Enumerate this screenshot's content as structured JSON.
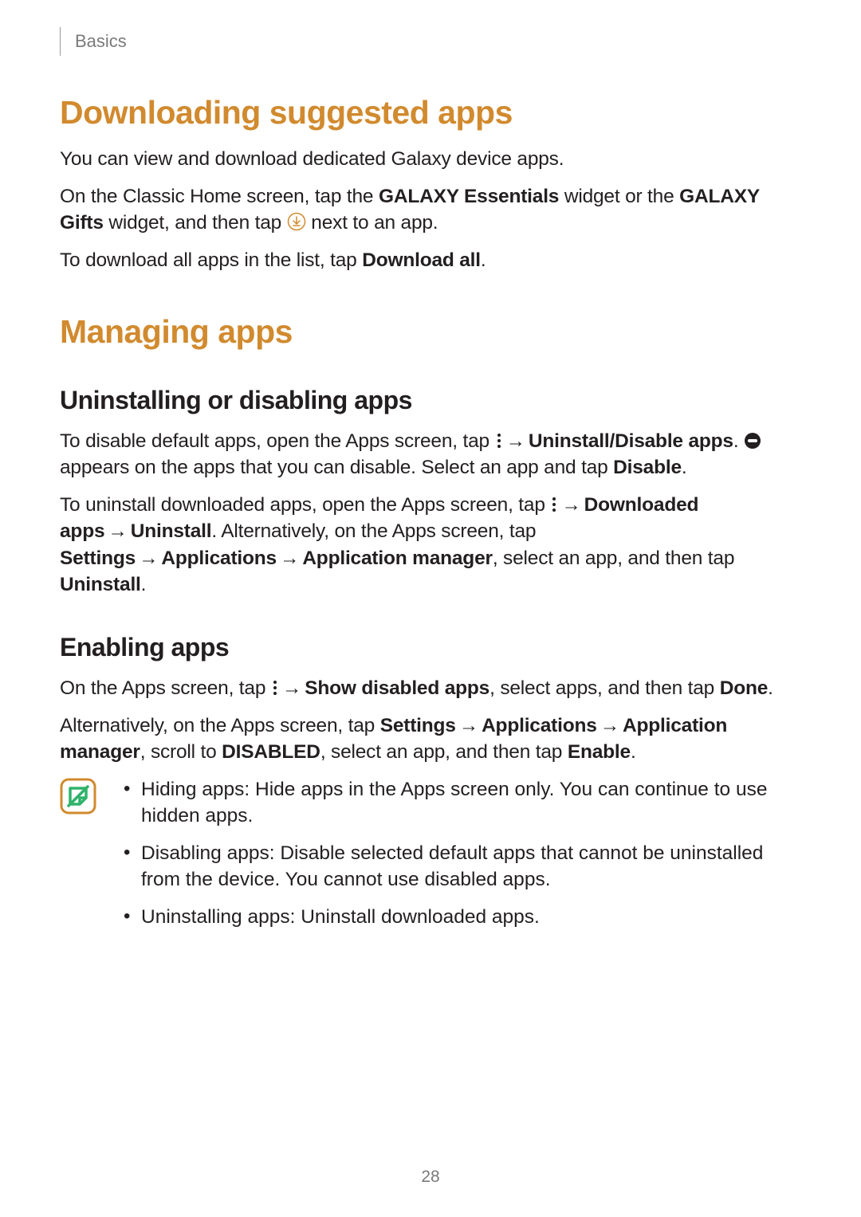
{
  "header": {
    "breadcrumb": "Basics"
  },
  "section1": {
    "heading": "Downloading suggested apps",
    "p1": "You can view and download dedicated Galaxy device apps.",
    "p2a": "On the Classic Home screen, tap the ",
    "p2b_bold": "GALAXY Essentials",
    "p2c": " widget or the ",
    "p2d_bold": "GALAXY Gifts",
    "p2e": " widget, and then tap ",
    "p2f": " next to an app.",
    "p3a": "To download all apps in the list, tap ",
    "p3b_bold": "Download all",
    "p3c": "."
  },
  "section2": {
    "heading": "Managing apps",
    "sub1": {
      "heading": "Uninstalling or disabling apps",
      "p1a": "To disable default apps, open the Apps screen, tap ",
      "p1_arrow": "→",
      "p1b_bold": "Uninstall/Disable apps",
      "p1c": ". ",
      "p1d": " appears on the apps that you can disable. Select an app and tap ",
      "p1e_bold": "Disable",
      "p1f": ".",
      "p2a": "To uninstall downloaded apps, open the Apps screen, tap ",
      "p2_arrow1": "→",
      "p2b_bold": "Downloaded apps",
      "p2_arrow2": "→",
      "p2c_bold": "Uninstall",
      "p2d": ". Alternatively, on the Apps screen, tap ",
      "p2e_bold": "Settings",
      "p2_arrow3": "→",
      "p2f_bold": "Applications",
      "p2_arrow4": "→",
      "p2g_bold": "Application manager",
      "p2h": ", select an app, and then tap ",
      "p2i_bold": "Uninstall",
      "p2j": "."
    },
    "sub2": {
      "heading": "Enabling apps",
      "p1a": "On the Apps screen, tap ",
      "p1_arrow": "→",
      "p1b_bold": "Show disabled apps",
      "p1c": ", select apps, and then tap ",
      "p1d_bold": "Done",
      "p1e": ".",
      "p2a": "Alternatively, on the Apps screen, tap ",
      "p2b_bold": "Settings",
      "p2_arrow1": "→",
      "p2c_bold": "Applications",
      "p2_arrow2": "→",
      "p2d_bold": "Application manager",
      "p2e": ", scroll to ",
      "p2f_bold": "DISABLED",
      "p2g": ", select an app, and then tap ",
      "p2h_bold": "Enable",
      "p2i": "."
    },
    "note": {
      "item1": "Hiding apps: Hide apps in the Apps screen only. You can continue to use hidden apps.",
      "item2": "Disabling apps: Disable selected default apps that cannot be uninstalled from the device. You cannot use disabled apps.",
      "item3": "Uninstalling apps: Uninstall downloaded apps."
    }
  },
  "pageNumber": "28"
}
